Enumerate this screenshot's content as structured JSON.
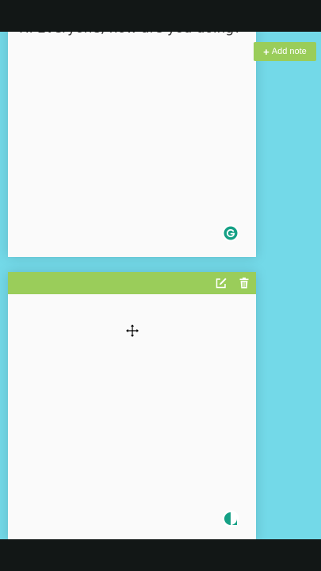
{
  "notes": [
    {
      "text": "Hi Everyone, how are you doing?",
      "icon": "grammarly-icon"
    },
    {
      "text": "",
      "actions": [
        "edit-icon",
        "trash-icon"
      ],
      "icon": "grammarly-icon"
    }
  ],
  "toolbar": {
    "add_note_label": "Add note",
    "add_note_icon": "plus-icon"
  },
  "colors": {
    "background": "#73d9e8",
    "accent": "#9acd5a",
    "note": "#fafafa",
    "bars": "#121716",
    "grammarly": "#15a085"
  }
}
